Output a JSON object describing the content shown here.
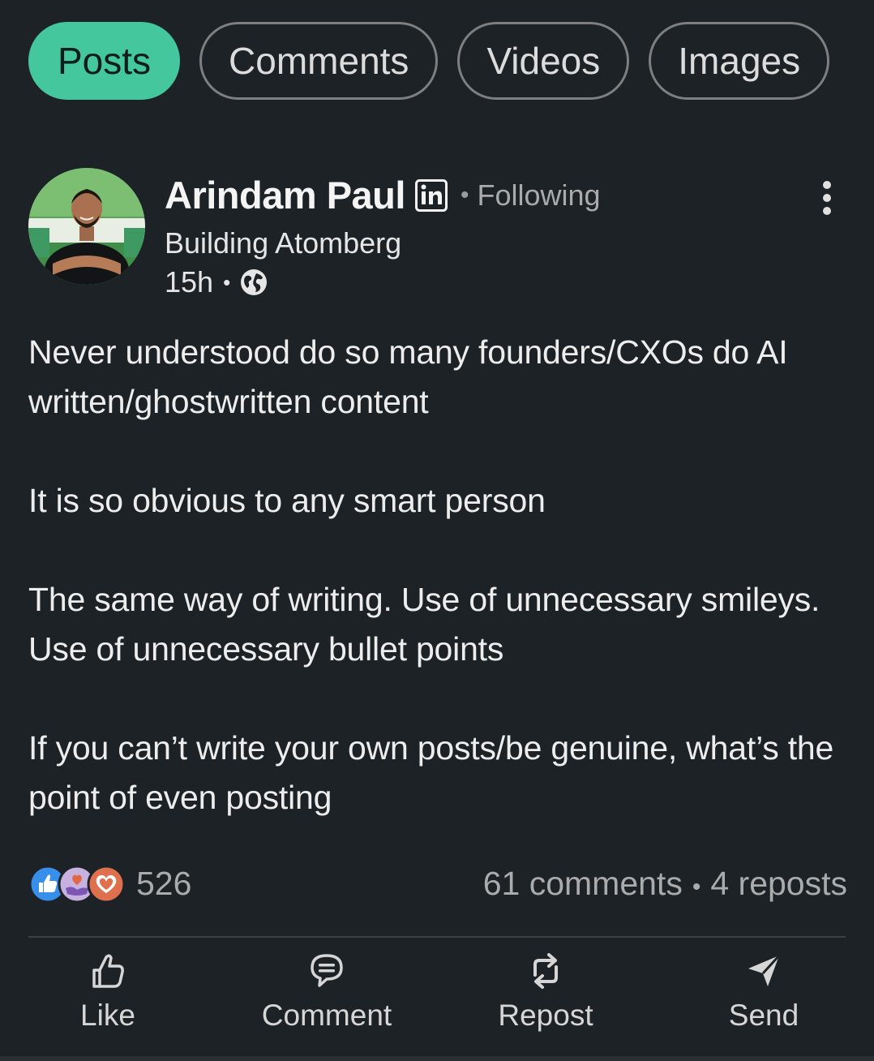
{
  "filter_tabs": [
    {
      "label": "Posts",
      "active": true
    },
    {
      "label": "Comments",
      "active": false
    },
    {
      "label": "Videos",
      "active": false
    },
    {
      "label": "Images",
      "active": false
    }
  ],
  "post": {
    "author": {
      "name": "Arindam Paul",
      "badge_icon": "linkedin-icon",
      "follow_status": "Following",
      "headline": "Building Atomberg"
    },
    "age": "15h",
    "visibility_icon": "globe-icon",
    "more_icon": "more-vertical-icon",
    "body_paragraphs": [
      "Never understood do so many founders/CXOs do AI written/ghostwritten content",
      "It is so obvious to any smart person",
      "The same way of writing. Use of unnecessary smileys. Use of unnecessary bullet points",
      "If you can’t write your own posts/be genuine, what’s the point of even posting"
    ],
    "reactions": {
      "icons": [
        "like-reaction-icon",
        "support-reaction-icon",
        "love-reaction-icon"
      ],
      "count": "526"
    },
    "comments_count": "61 comments",
    "reposts_count": "4 reposts"
  },
  "actions": [
    {
      "label": "Like",
      "icon": "thumbs-up-icon"
    },
    {
      "label": "Comment",
      "icon": "comment-icon"
    },
    {
      "label": "Repost",
      "icon": "repost-icon"
    },
    {
      "label": "Send",
      "icon": "send-icon"
    }
  ],
  "colors": {
    "background": "#1d2226",
    "active_tab": "#44c79c",
    "tab_border": "#7d7f80",
    "muted_text": "#a9abad"
  }
}
